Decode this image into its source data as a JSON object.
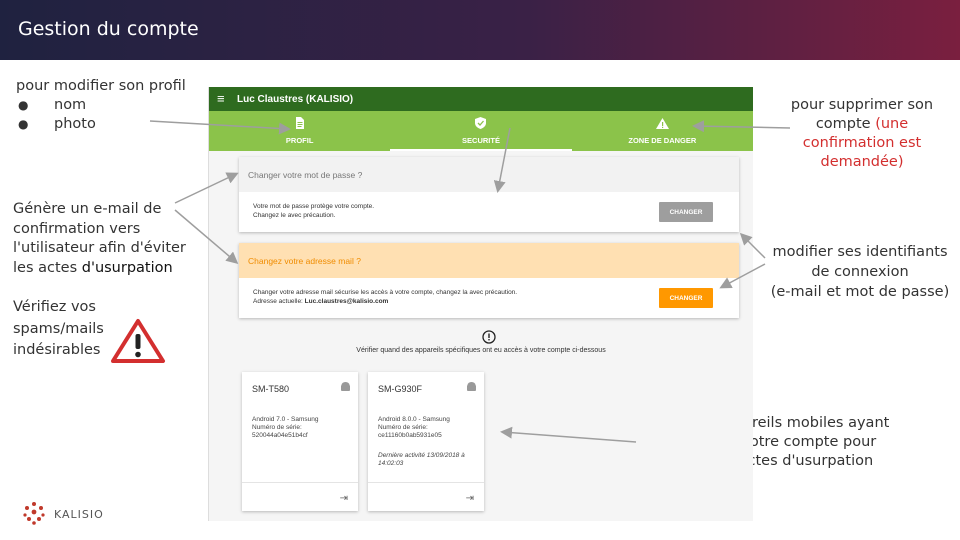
{
  "slide": {
    "title": "Gestion du compte"
  },
  "annotations": {
    "profil": {
      "text": "pour modifier son profil",
      "items": [
        "nom",
        "photo"
      ]
    },
    "supprimer": {
      "text": "pour supprimer son compte",
      "red": "(une confirmation est demandée)"
    },
    "email": {
      "line1": "Génère un e-mail de",
      "line2": "confirmation vers",
      "line3": "l'utilisateur afin d'éviter",
      "line4a": "les actes ",
      "line4b": "d'usurpation"
    },
    "verifiez": {
      "line1": "Vérifiez vos",
      "line2": "spams/mails",
      "line3": "indésirables"
    },
    "identifiants": {
      "line1": "modifier ses identifiants",
      "line2": "de connexion",
      "line3": "(e-mail et mot de passe)"
    },
    "appareils": {
      "line1": "liste des appareils mobiles ayant",
      "line2": "accédés à votre compte pour",
      "line3": "éviter les actes d'usurpation"
    }
  },
  "app": {
    "user": "Luc Claustres (KALISIO)",
    "tabs": [
      {
        "label": "PROFIL",
        "icon": "file-icon"
      },
      {
        "label": "SECURITÉ",
        "icon": "shield-icon"
      },
      {
        "label": "ZONE DE DANGER",
        "icon": "warning-icon"
      }
    ],
    "password": {
      "title": "Changer votre mot de passe ?",
      "desc1": "Votre mot de passe protège votre compte.",
      "desc2": "Changez le avec précaution.",
      "button": "CHANGER"
    },
    "email": {
      "title": "Changez votre adresse mail ?",
      "desc1": "Changer votre adresse mail sécurise les accès à votre compte, changez la avec précaution.",
      "current_label": "Adresse actuelle: ",
      "current_value": "Luc.claustres@kalisio.com",
      "button": "CHANGER"
    },
    "devices_hint": "Vérifier quand des appareils spécifiques ont eu accès à votre compte ci-dessous",
    "devices": [
      {
        "name": "SM-T580",
        "os": "Android 7.0 - Samsung",
        "serial_label": "Numéro de série:",
        "serial": "520044a04e51b4cf",
        "last": ""
      },
      {
        "name": "SM-G930F",
        "os": "Android 8.0.0 - Samsung",
        "serial_label": "Numéro de série:",
        "serial": "ce11160b0ab5931e05",
        "last": "Dernière activité 13/09/2018 à 14:02:03"
      }
    ]
  },
  "logo": {
    "text": "KALISIO"
  },
  "colors": {
    "green_dark": "#2e6b1f",
    "green": "#8bc34a",
    "orange": "#ff9800",
    "orange_light": "#ffe0b2",
    "red": "#d32f2f"
  }
}
